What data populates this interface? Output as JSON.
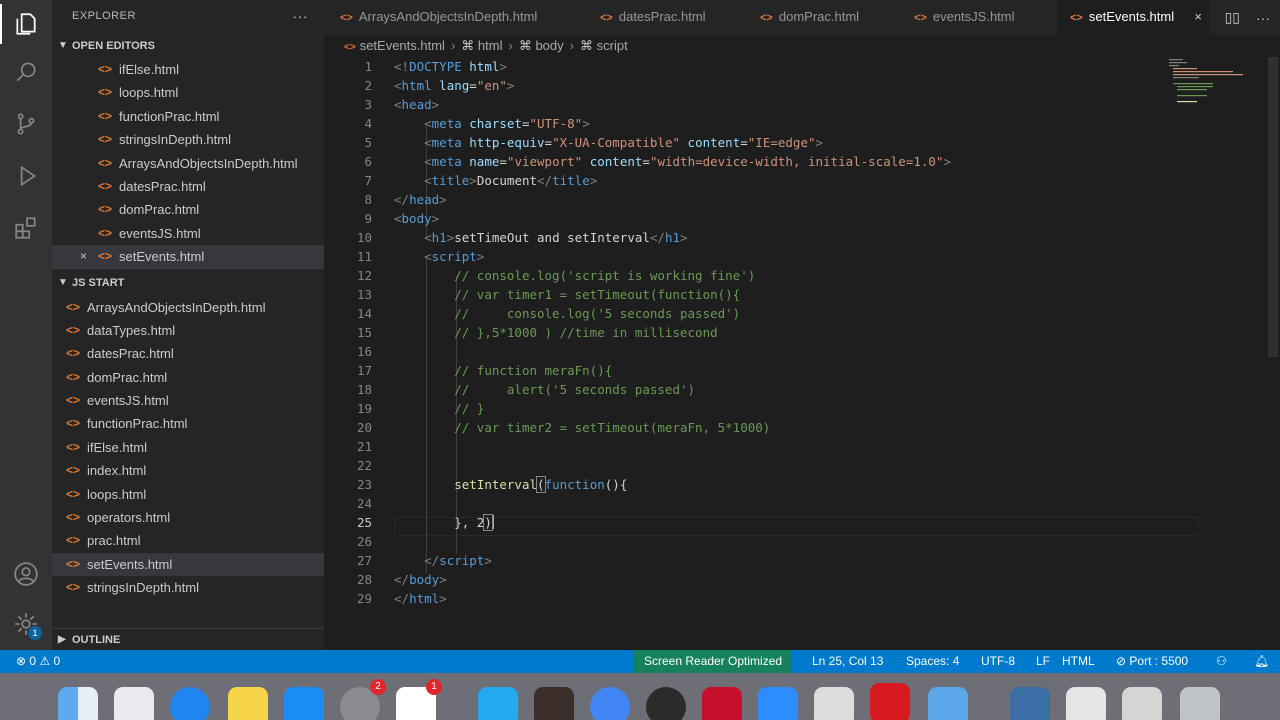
{
  "sidebar": {
    "title": "EXPLORER",
    "more": "···",
    "open_editors": {
      "title": "OPEN EDITORS",
      "close_icon": "×",
      "items": [
        "ifElse.html",
        "loops.html",
        "functionPrac.html",
        "stringsInDepth.html",
        "ArraysAndObjectsInDepth.html",
        "datesPrac.html",
        "domPrac.html",
        "eventsJS.html",
        "setEvents.html"
      ]
    },
    "project": {
      "title": "JS START",
      "items": [
        "ArraysAndObjectsInDepth.html",
        "dataTypes.html",
        "datesPrac.html",
        "domPrac.html",
        "eventsJS.html",
        "functionPrac.html",
        "ifElse.html",
        "index.html",
        "loops.html",
        "operators.html",
        "prac.html",
        "setEvents.html",
        "stringsInDepth.html"
      ]
    },
    "outline_title": "OUTLINE"
  },
  "activity": {
    "accounts_badge": "1"
  },
  "tabs": [
    {
      "label": "ArraysAndObjectsInDepth.html"
    },
    {
      "label": "datesPrac.html"
    },
    {
      "label": "domPrac.html"
    },
    {
      "label": "eventsJS.html"
    },
    {
      "label": "setEvents.html",
      "active": true
    }
  ],
  "tab_close": "×",
  "file_icon": "<>",
  "breadcrumb": [
    "setEvents.html",
    "html",
    "body",
    "script"
  ],
  "editor": {
    "cursor_line": "25"
  },
  "status": {
    "errors": "0",
    "warnings": "0",
    "screen_reader": "Screen Reader Optimized",
    "position": "Ln 25, Col 13",
    "spaces": "Spaces: 4",
    "encoding": "UTF-8",
    "eol": "LF",
    "language": "HTML",
    "port": "Port : 5500"
  },
  "dock": {
    "badges": [
      "2",
      "1"
    ]
  },
  "colors": {
    "status_bar": "#007acc",
    "editor_bg": "#1e1e1e",
    "sidebar_bg": "#252526",
    "html_icon": "#e37933"
  }
}
